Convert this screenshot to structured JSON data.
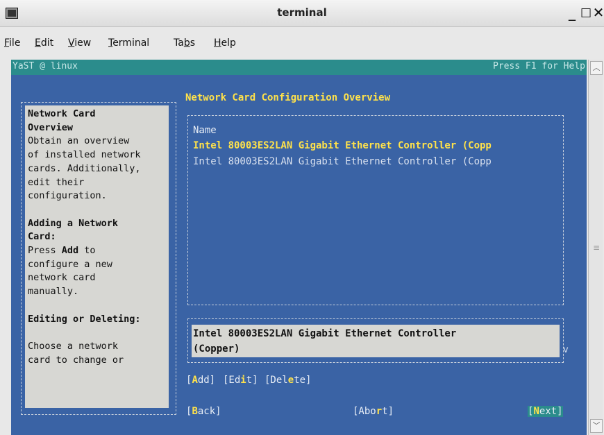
{
  "window": {
    "title": "terminal"
  },
  "menubar": {
    "items": [
      {
        "label": "File",
        "mnemonic": "F",
        "rest": "ile"
      },
      {
        "label": "Edit",
        "mnemonic": "E",
        "rest": "dit"
      },
      {
        "label": "View",
        "mnemonic": "V",
        "rest": "iew"
      },
      {
        "label": "Terminal",
        "mnemonic": "T",
        "rest": "erminal"
      },
      {
        "label": "Tabs",
        "pre": "Ta",
        "mnemonic": "b",
        "rest": "s"
      },
      {
        "label": "Help",
        "mnemonic": "H",
        "rest": "elp"
      }
    ]
  },
  "yast": {
    "topbar_left": "YaST @ linux",
    "topbar_right": "Press F1 for Help",
    "heading": "Network Card Configuration Overview",
    "help": {
      "title1": "Network Card",
      "title2": "Overview",
      "lines1": [
        "Obtain an overview",
        "of installed network",
        "cards. Additionally,",
        "edit their",
        "configuration."
      ],
      "section2_title1": "Adding a Network",
      "section2_title2": "Card:",
      "press": "Press ",
      "add_word": "Add",
      "press_rest": " to",
      "lines2": [
        "configure a new",
        "network card",
        "manually."
      ],
      "section3_title": "Editing or Deleting:",
      "lines3": [
        "Choose a network",
        "card to change or"
      ]
    },
    "table": {
      "header": "Name",
      "rows": [
        "Intel 80003ES2LAN Gigabit Ethernet Controller (Copp",
        "Intel 80003ES2LAN Gigabit Ethernet Controller (Copp"
      ]
    },
    "detail": {
      "line1": "Intel 80003ES2LAN Gigabit Ethernet Controller",
      "line2": "(Copper)",
      "scroll_marker": "v"
    },
    "buttons": {
      "add": {
        "pre": "[",
        "hk": "A",
        "post": "dd]"
      },
      "edit": {
        "pre": "[Ed",
        "hk": "i",
        "post": "t]"
      },
      "delete": {
        "pre": "[Del",
        "hk": "e",
        "post": "te]"
      },
      "back": {
        "pre": "[",
        "hk": "B",
        "post": "ack]"
      },
      "abort": {
        "pre": "[Abo",
        "hk": "r",
        "post": "t]"
      },
      "next": {
        "pre": "[",
        "hk": "N",
        "post": "ext]"
      }
    }
  },
  "colors": {
    "terminal_bg": "#3a63a5",
    "topbar_bg": "#2b8c8c",
    "highlight": "#ffe24a",
    "panel_bg": "#d7d7d3"
  }
}
